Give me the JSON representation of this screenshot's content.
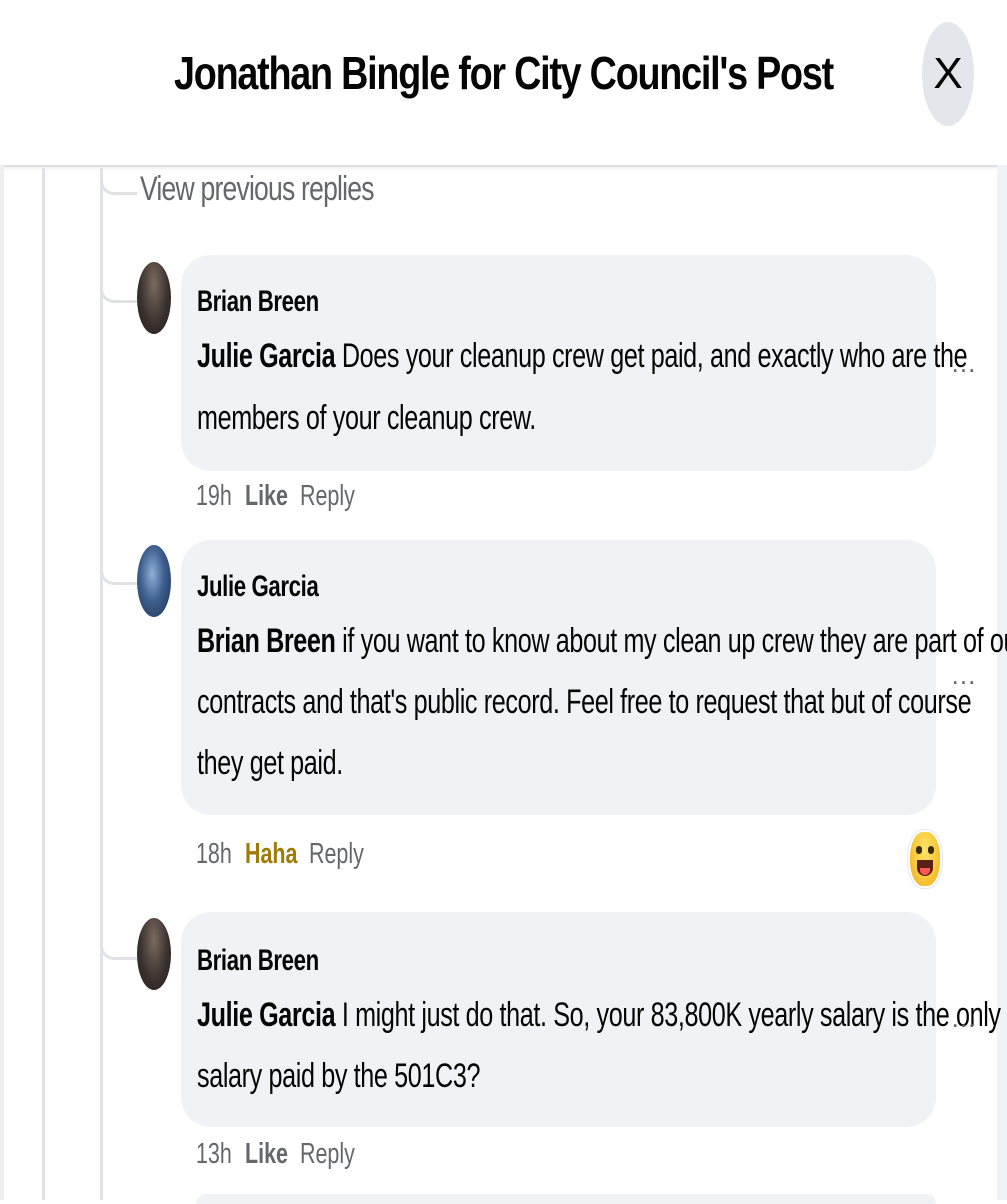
{
  "header": {
    "title": "Jonathan Bingle for City Council's Post",
    "close_label": "X"
  },
  "thread": {
    "view_previous_label": "View previous replies",
    "more_label": "...",
    "comments": [
      {
        "author": "Brian Breen",
        "mention": "Julie Garcia",
        "lines": [
          " Does your cleanup crew get paid, and exactly who are the",
          "members of your cleanup crew."
        ],
        "time": "19h",
        "reaction_action": "Like",
        "reply_label": "Reply"
      },
      {
        "author": "Julie Garcia",
        "mention": "Brian Breen",
        "lines": [
          " if you want to know about my clean up crew they are part of our",
          "contracts and that's public record. Feel free to request that but of course",
          "they get paid."
        ],
        "time": "18h",
        "reaction_action": "Haha",
        "reply_label": "Reply",
        "reaction_icon": "haha-emoji-icon"
      },
      {
        "author": "Brian Breen",
        "mention": "Julie Garcia",
        "lines": [
          " I might just do that. So, your 83,800K yearly salary is the only",
          "salary paid by the 501C3?"
        ],
        "time": "13h",
        "reaction_action": "Like",
        "reply_label": "Reply"
      }
    ]
  },
  "colors": {
    "bubble": "#f0f2f5",
    "secondary_text": "#65676b",
    "haha_active": "#a07a05",
    "close_button_bg": "#e4e6eb"
  }
}
